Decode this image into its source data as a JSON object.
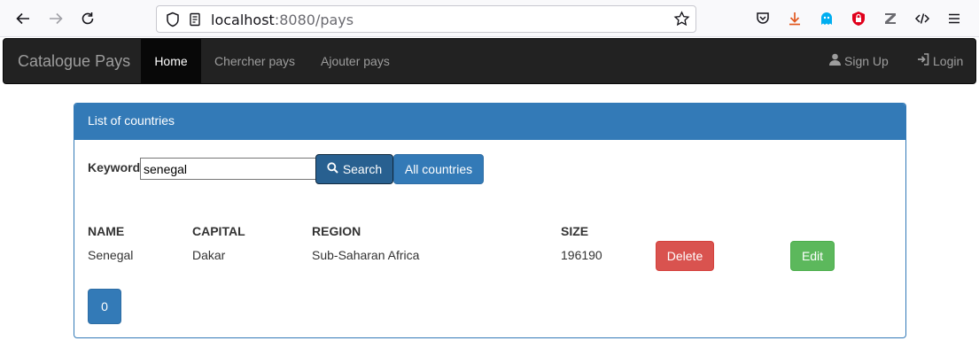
{
  "browser": {
    "url_host": "localhost",
    "url_rest": ":8080/pays"
  },
  "navbar": {
    "brand": "Catalogue Pays",
    "items": [
      {
        "label": "Home",
        "active": true
      },
      {
        "label": "Chercher pays",
        "active": false
      },
      {
        "label": "Ajouter pays",
        "active": false
      }
    ],
    "sign_up": "Sign Up",
    "login": "Login"
  },
  "panel": {
    "heading": "List of countries",
    "keyword_label": "Keyword",
    "keyword_value": "senegal",
    "search_button": "Search",
    "all_button": "All countries",
    "columns": [
      "NAME",
      "CAPITAL",
      "REGION",
      "SIZE"
    ],
    "rows": [
      {
        "name": "Senegal",
        "capital": "Dakar",
        "region": "Sub-Saharan Africa",
        "size": "196190"
      }
    ],
    "delete_button": "Delete",
    "edit_button": "Edit",
    "pages": [
      "0"
    ]
  },
  "colors": {
    "primary": "#337ab7",
    "danger": "#d9534f",
    "success": "#5cb85c",
    "navbar": "#222222"
  }
}
